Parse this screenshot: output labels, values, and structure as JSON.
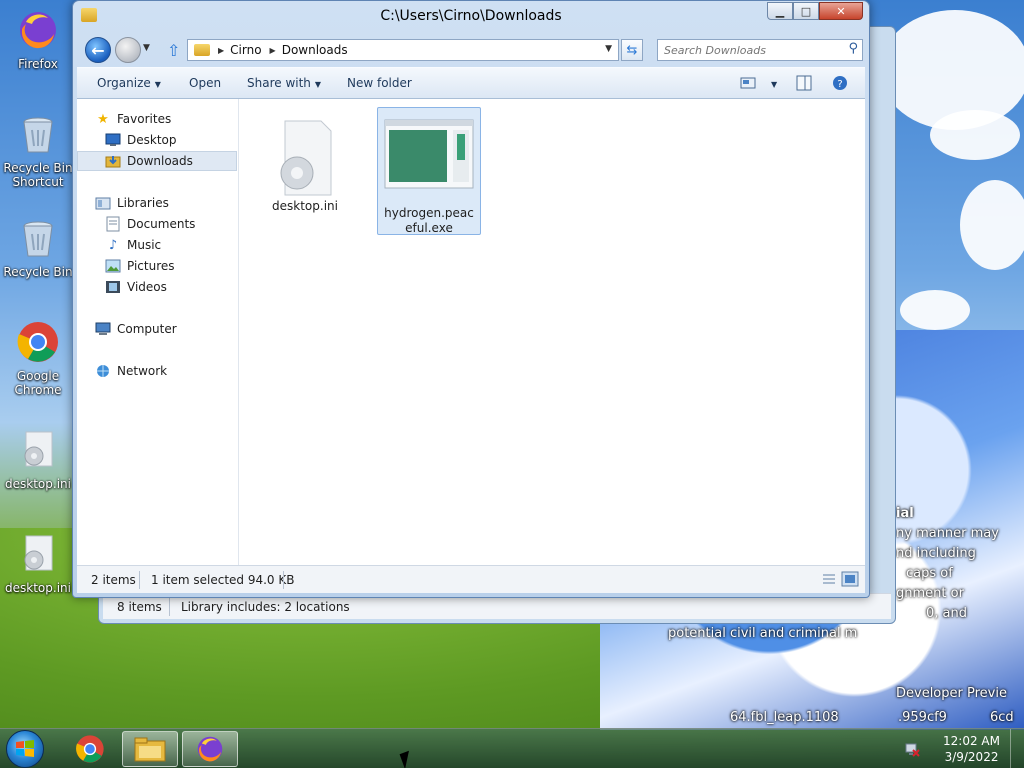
{
  "window": {
    "title": "C:\\Users\\Cirno\\Downloads",
    "breadcrumb": [
      "Cirno",
      "Downloads"
    ],
    "search_placeholder": "Search Downloads"
  },
  "toolbar": {
    "organize": "Organize",
    "open": "Open",
    "share_with": "Share with",
    "new_folder": "New folder"
  },
  "nav": {
    "favorites": "Favorites",
    "desktop": "Desktop",
    "downloads": "Downloads",
    "libraries": "Libraries",
    "documents": "Documents",
    "music": "Music",
    "pictures": "Pictures",
    "videos": "Videos",
    "computer": "Computer",
    "network": "Network"
  },
  "files": [
    {
      "name": "desktop.ini",
      "selected": false
    },
    {
      "name": "hydrogen.peaceful.exe",
      "selected": true
    }
  ],
  "status": {
    "count": "2 items",
    "selection": "1 item selected  94.0 KB"
  },
  "background_window": {
    "count": "8 items",
    "library": "Library includes: 2 locations"
  },
  "desktop_icons": [
    {
      "label": "Firefox",
      "icon": "firefox-icon"
    },
    {
      "label": "Recycle Bin Shortcut",
      "icon": "recycle-bin-icon"
    },
    {
      "label": "Recycle Bin",
      "icon": "recycle-bin-icon"
    },
    {
      "label": "Google Chrome",
      "icon": "chrome-icon"
    },
    {
      "label": "desktop.ini",
      "icon": "settings-file-icon"
    },
    {
      "label": "desktop.ini",
      "icon": "settings-file-icon"
    }
  ],
  "wallpaper_text": {
    "line1": "ial",
    "line2": "ny manner may",
    "line3": "nd including",
    "line4": "caps of",
    "line5": "gnment or",
    "line6": "0, and",
    "line7": "potential civil and criminal m",
    "line8": "Developer Previe",
    "line9": "64.fbl_leap.1108",
    "line10": ".959cf9",
    "line11": "6cd"
  },
  "taskbar": {
    "time": "12:02 AM",
    "date": "3/9/2022"
  }
}
